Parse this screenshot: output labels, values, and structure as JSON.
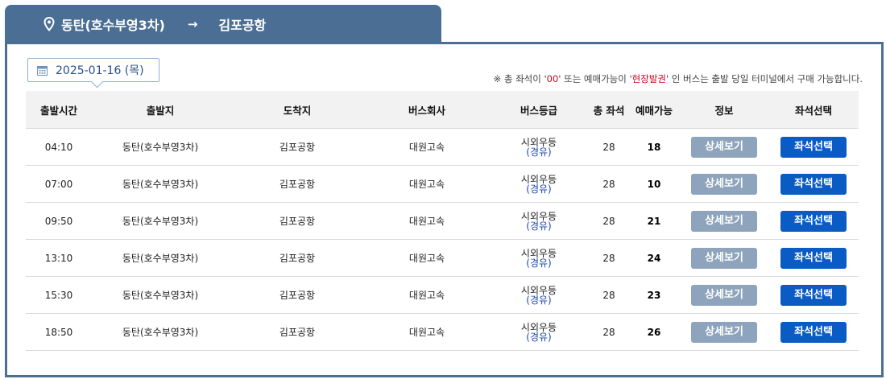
{
  "route": {
    "from": "동탄(호수부영3차)",
    "arrow": "→",
    "to": "김포공항"
  },
  "date": {
    "value": "2025-01-16 (목)"
  },
  "notice": {
    "part1": "※ 총 좌석이 '",
    "zero": "00",
    "part2": "' 또는 예매가능이 '",
    "onsite": "현장발권",
    "part3": "' 인 버스는 출발 당일 터미널에서 구매 가능합니다."
  },
  "table": {
    "headers": {
      "depart_time": "출발시간",
      "origin": "출발지",
      "destination": "도착지",
      "company": "버스회사",
      "grade": "버스등급",
      "total_seats": "총 좌석",
      "available": "예매가능",
      "info": "정보",
      "seat_select": "좌석선택"
    },
    "rows": [
      {
        "time": "04:10",
        "origin": "동탄(호수부영3차)",
        "destination": "김포공항",
        "company": "대원고속",
        "grade": "시외우등",
        "via": "(경유)",
        "total": "28",
        "available": "18",
        "detail_label": "상세보기",
        "seat_label": "좌석선택"
      },
      {
        "time": "07:00",
        "origin": "동탄(호수부영3차)",
        "destination": "김포공항",
        "company": "대원고속",
        "grade": "시외우등",
        "via": "(경유)",
        "total": "28",
        "available": "10",
        "detail_label": "상세보기",
        "seat_label": "좌석선택"
      },
      {
        "time": "09:50",
        "origin": "동탄(호수부영3차)",
        "destination": "김포공항",
        "company": "대원고속",
        "grade": "시외우등",
        "via": "(경유)",
        "total": "28",
        "available": "21",
        "detail_label": "상세보기",
        "seat_label": "좌석선택"
      },
      {
        "time": "13:10",
        "origin": "동탄(호수부영3차)",
        "destination": "김포공항",
        "company": "대원고속",
        "grade": "시외우등",
        "via": "(경유)",
        "total": "28",
        "available": "24",
        "detail_label": "상세보기",
        "seat_label": "좌석선택"
      },
      {
        "time": "15:30",
        "origin": "동탄(호수부영3차)",
        "destination": "김포공항",
        "company": "대원고속",
        "grade": "시외우등",
        "via": "(경유)",
        "total": "28",
        "available": "23",
        "detail_label": "상세보기",
        "seat_label": "좌석선택"
      },
      {
        "time": "18:50",
        "origin": "동탄(호수부영3차)",
        "destination": "김포공항",
        "company": "대원고속",
        "grade": "시외우등",
        "via": "(경유)",
        "total": "28",
        "available": "26",
        "detail_label": "상세보기",
        "seat_label": "좌석선택"
      }
    ]
  },
  "icons": {
    "route_pin": "location-pin-icon",
    "calendar": "calendar-icon"
  },
  "colors": {
    "header_bar": "#4b6f94",
    "seat_button": "#0a5bc4",
    "detail_button": "#8ea4bc",
    "notice_highlight": "#d0021b",
    "via_text": "#1a46b0"
  }
}
